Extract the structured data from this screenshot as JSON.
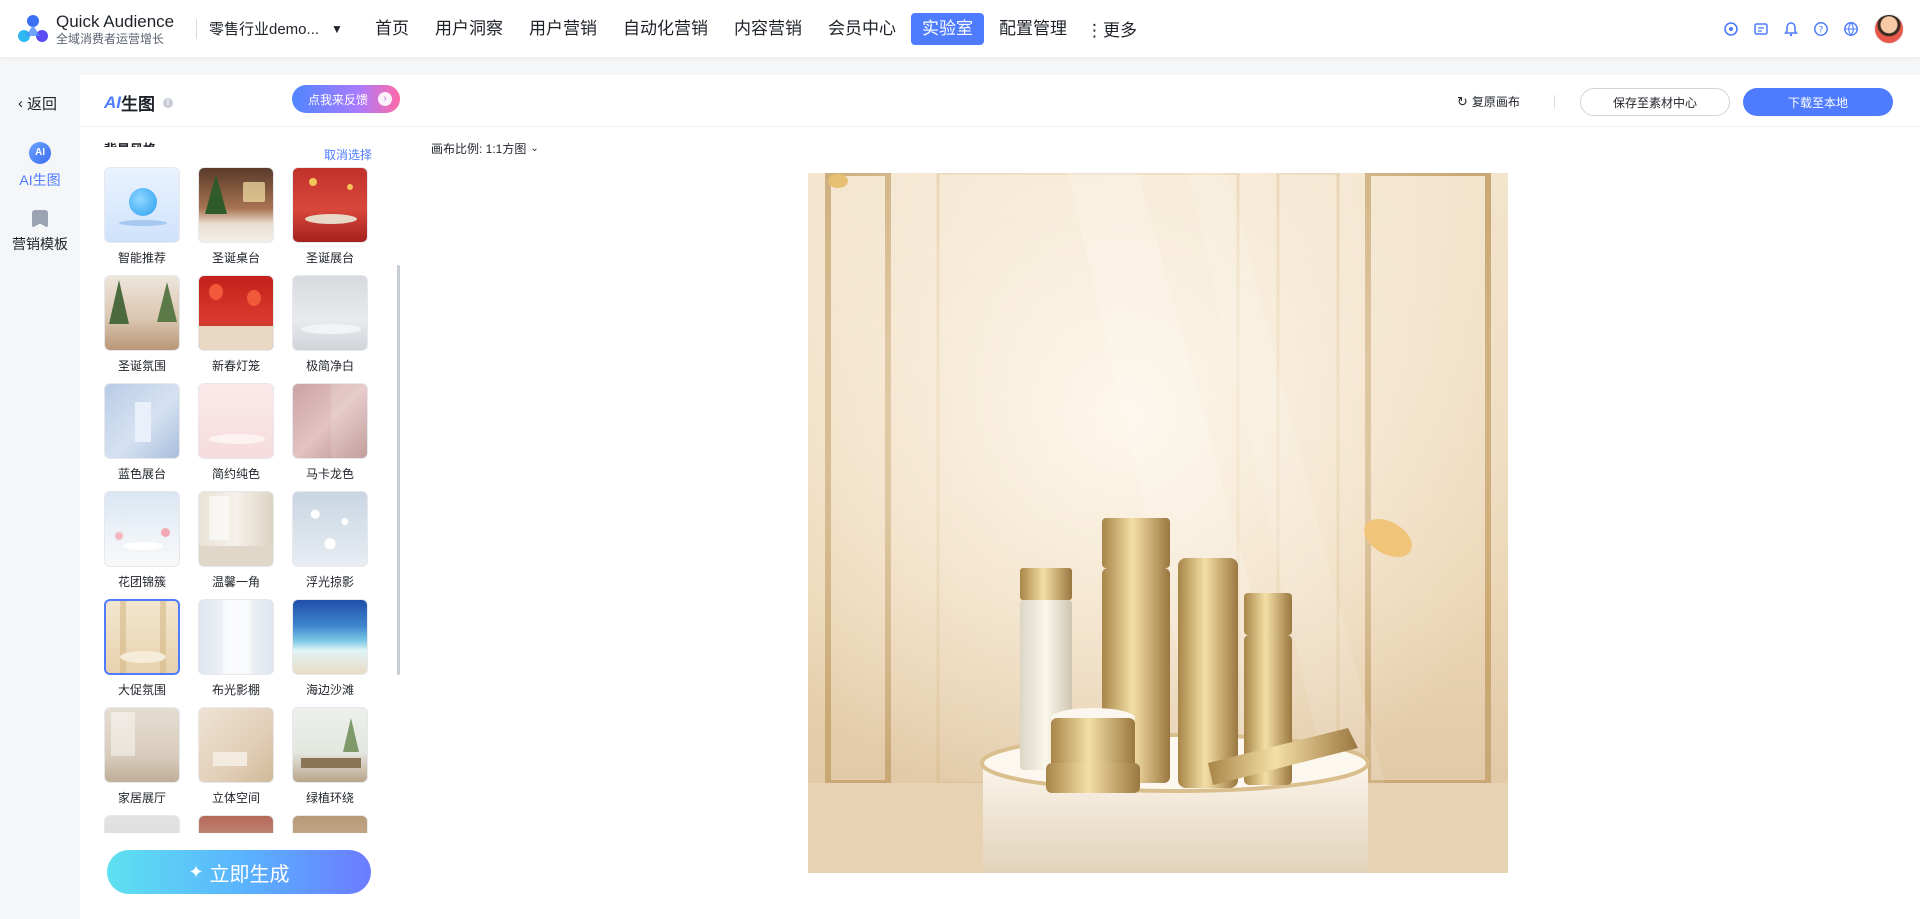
{
  "header": {
    "brand_name": "Quick Audience",
    "brand_sub": "全域消费者运营增长",
    "workspace": "零售行业demo...",
    "nav": [
      {
        "label": "首页",
        "active": false
      },
      {
        "label": "用户洞察",
        "active": false
      },
      {
        "label": "用户营销",
        "active": false
      },
      {
        "label": "自动化营销",
        "active": false
      },
      {
        "label": "内容营销",
        "active": false
      },
      {
        "label": "会员中心",
        "active": false
      },
      {
        "label": "实验室",
        "active": true
      },
      {
        "label": "配置管理",
        "active": false
      }
    ],
    "more_label": "更多",
    "icons": [
      "ai-assistant-icon",
      "ticket-icon",
      "bell-icon",
      "help-icon",
      "language-icon"
    ]
  },
  "rail": {
    "back_label": "返回",
    "items": [
      {
        "label": "AI生图",
        "icon": "ai-icon",
        "active": true
      },
      {
        "label": "营销模板",
        "icon": "bookmark-icon",
        "active": false
      }
    ]
  },
  "panel": {
    "title_ai": "AI",
    "title_rest": "生图",
    "feedback_label": "点我来反馈",
    "section_label": "背景风格",
    "cancel_select_label": "取消选择",
    "styles": [
      {
        "name": "智能推荐"
      },
      {
        "name": "圣诞桌台"
      },
      {
        "name": "圣诞展台"
      },
      {
        "name": "圣诞氛围"
      },
      {
        "name": "新春灯笼"
      },
      {
        "name": "极简净白"
      },
      {
        "name": "蓝色展台"
      },
      {
        "name": "简约纯色"
      },
      {
        "name": "马卡龙色"
      },
      {
        "name": "花团锦簇"
      },
      {
        "name": "温馨一角"
      },
      {
        "name": "浮光掠影"
      },
      {
        "name": "大促氛围",
        "selected": true
      },
      {
        "name": "布光影棚"
      },
      {
        "name": "海边沙滩"
      },
      {
        "name": "家居展厅"
      },
      {
        "name": "立体空间"
      },
      {
        "name": "绿植环绕"
      }
    ],
    "generate_label": "立即生成"
  },
  "canvas": {
    "restore_label": "复原画布",
    "save_label": "保存至素材中心",
    "download_label": "下载至本地",
    "ratio_label": "画布比例: 1:1方图"
  },
  "colors": {
    "accent": "#4f7cff",
    "background": "#f5f6f8"
  }
}
